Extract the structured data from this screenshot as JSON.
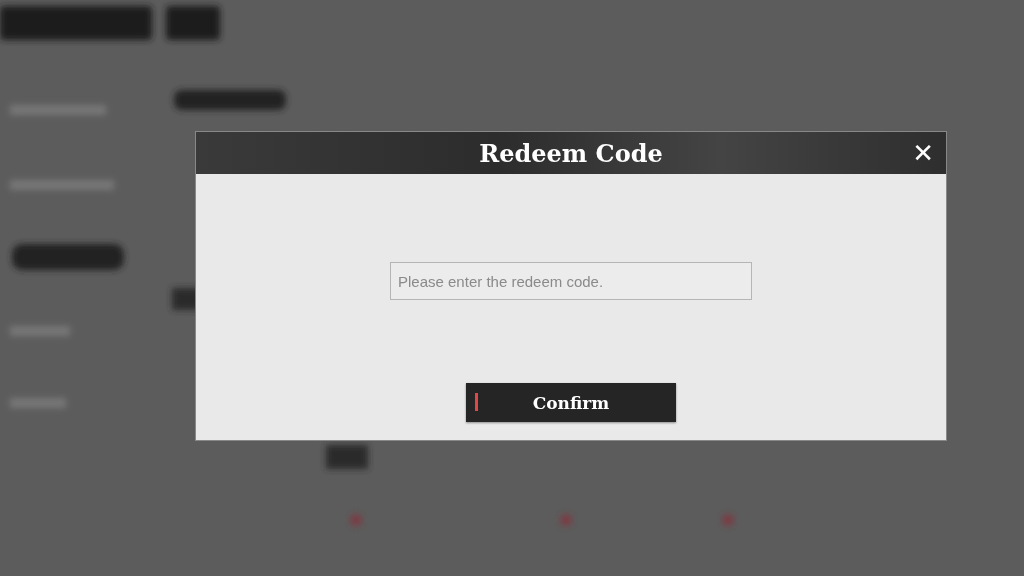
{
  "dialog": {
    "title": "Redeem Code",
    "close": "✕",
    "code_field": {
      "placeholder": "Please enter the redeem code."
    },
    "confirm_button": {
      "label": "Confirm"
    }
  }
}
